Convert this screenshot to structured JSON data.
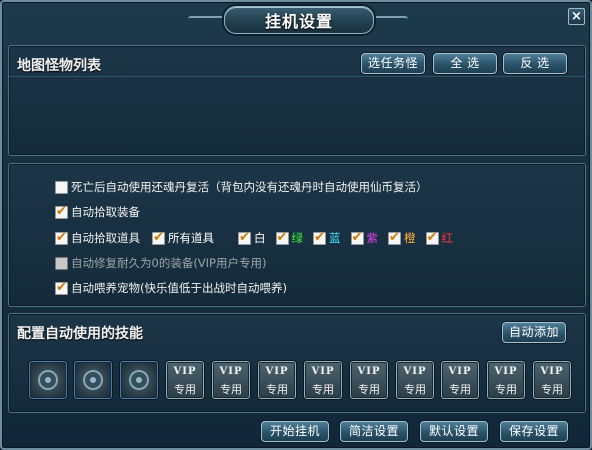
{
  "window": {
    "title": "挂机设置",
    "close_label": "×"
  },
  "monster_panel": {
    "title": "地图怪物列表",
    "buttons": [
      "选任务怪",
      "全 选",
      "反 选"
    ]
  },
  "options": [
    {
      "label": "死亡后自动使用还魂丹复活（背包内没有还魂丹时自动使用仙币复活）",
      "checked": false,
      "disabled": false
    },
    {
      "label": "自动拾取装备",
      "checked": true,
      "disabled": false
    },
    {
      "label": "自动修复耐久为0的装备(VIP用户专用)",
      "checked": false,
      "disabled": true
    },
    {
      "label": "自动喂养宠物(快乐值低于出战时自动喂养)",
      "checked": true,
      "disabled": false
    }
  ],
  "pickup_items": {
    "label": "自动拾取道具",
    "checked": true,
    "sub": [
      {
        "label": "所有道具",
        "checked": true,
        "color": "#ffffff"
      },
      {
        "label": "白",
        "checked": true,
        "color": "#ffffff"
      },
      {
        "label": "绿",
        "checked": true,
        "color": "#3cf03c"
      },
      {
        "label": "蓝",
        "checked": true,
        "color": "#3fe3ff"
      },
      {
        "label": "紫",
        "checked": true,
        "color": "#e23cf0"
      },
      {
        "label": "橙",
        "checked": true,
        "color": "#ffb43c"
      },
      {
        "label": "红",
        "checked": true,
        "color": "#ff3535"
      }
    ]
  },
  "skills_panel": {
    "title": "配置自动使用的技能",
    "auto_add_label": "自动添加",
    "empty_slots": 3,
    "vip_slots": 9,
    "vip_label": "VIP",
    "vip_sub": "专用"
  },
  "footer_buttons": [
    "开始挂机",
    "简洁设置",
    "默认设置",
    "保存设置"
  ]
}
